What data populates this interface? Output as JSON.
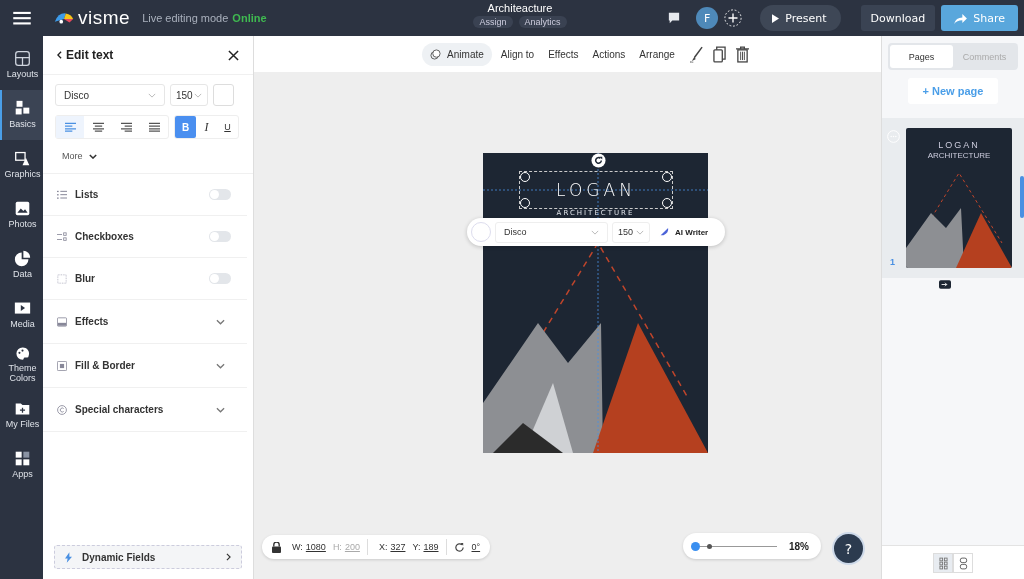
{
  "topbar": {
    "logo": "visme",
    "mode_label": "Live editing mode",
    "status": "Online",
    "doc_title": "Architeacture",
    "doc_actions": [
      "Assign",
      "Analytics"
    ],
    "avatar": "F",
    "present": "Present",
    "download": "Download",
    "share": "Share"
  },
  "rail": [
    {
      "kind": "layouts",
      "label": "Layouts",
      "selected": false
    },
    {
      "kind": "basics",
      "label": "Basics",
      "selected": true
    },
    {
      "kind": "graphics",
      "label": "Graphics",
      "selected": false
    },
    {
      "kind": "photos",
      "label": "Photos",
      "selected": false
    },
    {
      "kind": "data",
      "label": "Data",
      "selected": false
    },
    {
      "kind": "media",
      "label": "Media",
      "selected": false
    },
    {
      "kind": "colors",
      "label": "Theme Colors",
      "selected": false
    },
    {
      "kind": "files",
      "label": "My Files",
      "selected": false
    },
    {
      "kind": "apps",
      "label": "Apps",
      "selected": false
    }
  ],
  "panel": {
    "title": "Edit text",
    "font": "Disco",
    "size": "150",
    "align": [
      {
        "kind": "left",
        "selected": true
      },
      {
        "kind": "center",
        "selected": false
      },
      {
        "kind": "right",
        "selected": false
      },
      {
        "kind": "justify",
        "selected": false
      }
    ],
    "styles": [
      {
        "label": "B",
        "kind": "bold",
        "selected": true
      },
      {
        "label": "I",
        "kind": "italic",
        "selected": false
      },
      {
        "label": "U",
        "kind": "underline",
        "selected": false
      }
    ],
    "more": "More",
    "sections": [
      {
        "kind": "toggle",
        "label": "Lists",
        "on": false
      },
      {
        "kind": "toggle",
        "label": "Checkboxes",
        "on": false
      },
      {
        "kind": "toggle",
        "label": "Blur",
        "on": false
      },
      {
        "kind": "expand",
        "label": "Effects"
      },
      {
        "kind": "expand",
        "label": "Fill & Border"
      },
      {
        "kind": "expand",
        "label": "Special characters"
      }
    ],
    "dynamic": "Dynamic Fields"
  },
  "toolbar": {
    "items": [
      {
        "label": "Animate",
        "selected": true
      },
      {
        "label": "Align to",
        "selected": false
      },
      {
        "label": "Effects",
        "selected": false
      },
      {
        "label": "Actions",
        "selected": false
      },
      {
        "label": "Arrange",
        "selected": false
      }
    ]
  },
  "poster": {
    "title": "LOGAN",
    "subtitle": "ARCHITECTURE"
  },
  "text_toolbar": {
    "font": "Disco",
    "size": "150",
    "ai": "AI Writer"
  },
  "position": [
    {
      "label": "W:",
      "value": "1080",
      "disabled": false
    },
    {
      "label": "H:",
      "value": "200",
      "disabled": true
    },
    {
      "label": "X:",
      "value": "327",
      "disabled": false
    },
    {
      "label": "Y:",
      "value": "189",
      "disabled": false
    }
  ],
  "rotation": "0°",
  "zoom": {
    "level": 0.0,
    "reading": "18%"
  },
  "help": "?",
  "pages_panel": {
    "tabs": [
      {
        "label": "Pages",
        "selected": true
      },
      {
        "label": "Comments",
        "selected": false
      }
    ],
    "new_page": "+ New page",
    "page_number": "1",
    "thumb_title": "LOGAN",
    "thumb_subtitle": "ARCHITECTURE",
    "views": [
      {
        "kind": "grid",
        "selected": true
      },
      {
        "kind": "list",
        "selected": false
      }
    ]
  }
}
